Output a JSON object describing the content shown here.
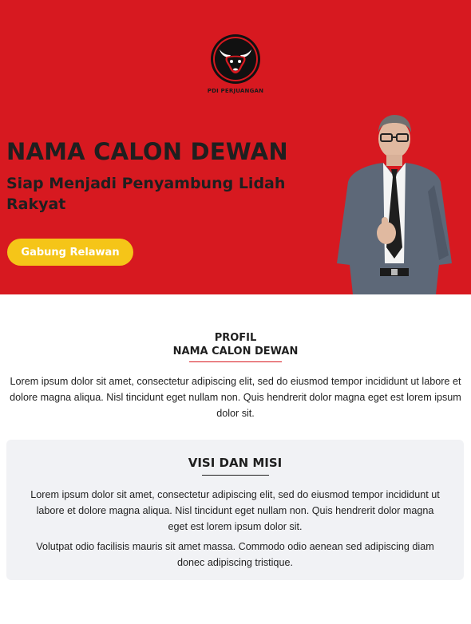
{
  "hero": {
    "logo_caption": "PDI PERJUANGAN",
    "title": "NAMA CALON DEWAN",
    "subtitle": "Siap Menjadi Penyambung Lidah Rakyat",
    "cta_label": "Gabung Relawan",
    "background_color": "#d71920",
    "cta_color": "#f5c518"
  },
  "profile": {
    "kicker": "PROFIL",
    "name": "NAMA CALON DEWAN",
    "text": "Lorem ipsum dolor sit amet, consectetur adipiscing elit, sed do eiusmod tempor incididunt ut labore et dolore magna aliqua. Nisl tincidunt eget nullam non. Quis hendrerit dolor magna eget est lorem ipsum dolor sit."
  },
  "visi_misi": {
    "title": "VISI DAN MISI",
    "paragraphs": [
      "Lorem ipsum dolor sit amet, consectetur adipiscing elit, sed do eiusmod tempor incididunt ut labore et dolore magna aliqua. Nisl tincidunt eget nullam non. Quis hendrerit dolor magna eget est lorem ipsum dolor sit.",
      "Volutpat odio facilisis mauris sit amet massa. Commodo odio aenean sed adipiscing diam donec adipiscing tristique."
    ]
  },
  "icons": {
    "logo": "bull-head-logo-icon",
    "photo": "candidate-photo"
  }
}
